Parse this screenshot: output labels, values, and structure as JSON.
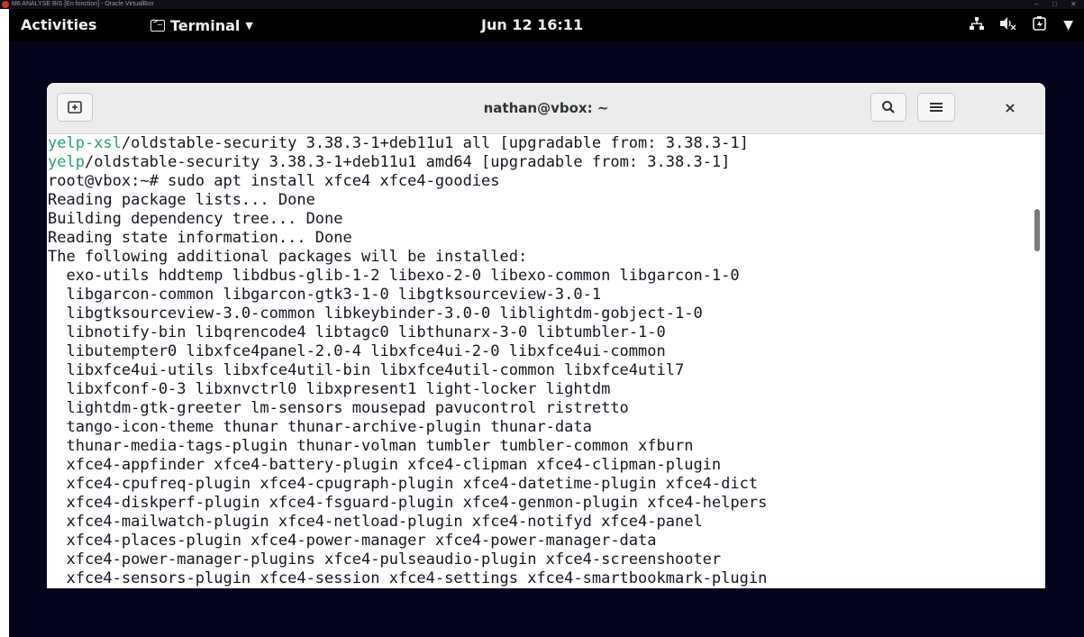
{
  "host": {
    "title": "M6 ANALYSE BIS [En fonction] - Oracle VirtualBox",
    "controls": [
      "–",
      "□",
      "✕"
    ]
  },
  "topbar": {
    "activities": "Activities",
    "app_menu": "Terminal",
    "clock": "Jun 12  16:11",
    "tray_icons": [
      "network-icon",
      "volume-muted-icon",
      "battery-icon",
      "system-menu-icon"
    ]
  },
  "window": {
    "title": "nathan@vbox: ~",
    "close": "×"
  },
  "terminal": {
    "lines": [
      {
        "pkg": "yelp-xsl",
        "rest": "/oldstable-security 3.38.3-1+deb11u1 all [upgradable from: 3.38.3-1]"
      },
      {
        "pkg": "yelp",
        "rest": "/oldstable-security 3.38.3-1+deb11u1 amd64 [upgradable from: 3.38.3-1]"
      },
      {
        "pkg": "",
        "rest": "root@vbox:~# sudo apt install xfce4 xfce4-goodies"
      },
      {
        "pkg": "",
        "rest": "Reading package lists... Done"
      },
      {
        "pkg": "",
        "rest": "Building dependency tree... Done"
      },
      {
        "pkg": "",
        "rest": "Reading state information... Done"
      },
      {
        "pkg": "",
        "rest": "The following additional packages will be installed:"
      },
      {
        "pkg": "",
        "rest": "  exo-utils hddtemp libdbus-glib-1-2 libexo-2-0 libexo-common libgarcon-1-0"
      },
      {
        "pkg": "",
        "rest": "  libgarcon-common libgarcon-gtk3-1-0 libgtksourceview-3.0-1"
      },
      {
        "pkg": "",
        "rest": "  libgtksourceview-3.0-common libkeybinder-3.0-0 liblightdm-gobject-1-0"
      },
      {
        "pkg": "",
        "rest": "  libnotify-bin libqrencode4 libtagc0 libthunarx-3-0 libtumbler-1-0"
      },
      {
        "pkg": "",
        "rest": "  libutempter0 libxfce4panel-2.0-4 libxfce4ui-2-0 libxfce4ui-common"
      },
      {
        "pkg": "",
        "rest": "  libxfce4ui-utils libxfce4util-bin libxfce4util-common libxfce4util7"
      },
      {
        "pkg": "",
        "rest": "  libxfconf-0-3 libxnvctrl0 libxpresent1 light-locker lightdm"
      },
      {
        "pkg": "",
        "rest": "  lightdm-gtk-greeter lm-sensors mousepad pavucontrol ristretto"
      },
      {
        "pkg": "",
        "rest": "  tango-icon-theme thunar thunar-archive-plugin thunar-data"
      },
      {
        "pkg": "",
        "rest": "  thunar-media-tags-plugin thunar-volman tumbler tumbler-common xfburn"
      },
      {
        "pkg": "",
        "rest": "  xfce4-appfinder xfce4-battery-plugin xfce4-clipman xfce4-clipman-plugin"
      },
      {
        "pkg": "",
        "rest": "  xfce4-cpufreq-plugin xfce4-cpugraph-plugin xfce4-datetime-plugin xfce4-dict"
      },
      {
        "pkg": "",
        "rest": "  xfce4-diskperf-plugin xfce4-fsguard-plugin xfce4-genmon-plugin xfce4-helpers"
      },
      {
        "pkg": "",
        "rest": "  xfce4-mailwatch-plugin xfce4-netload-plugin xfce4-notifyd xfce4-panel"
      },
      {
        "pkg": "",
        "rest": "  xfce4-places-plugin xfce4-power-manager xfce4-power-manager-data"
      },
      {
        "pkg": "",
        "rest": "  xfce4-power-manager-plugins xfce4-pulseaudio-plugin xfce4-screenshooter"
      },
      {
        "pkg": "",
        "rest": "  xfce4-sensors-plugin xfce4-session xfce4-settings xfce4-smartbookmark-plugin"
      }
    ]
  }
}
